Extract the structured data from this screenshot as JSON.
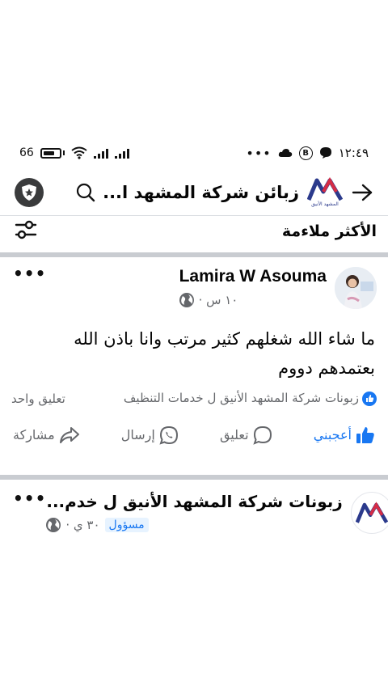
{
  "status_bar": {
    "battery": "66",
    "time": "١٢:٤٩"
  },
  "header": {
    "title": "زبائن شركة المشهد ا...",
    "logo_text": "المشهد الأنيق"
  },
  "sort": {
    "label": "الأكثر ملاءمة"
  },
  "post1": {
    "author": "Lamira W Asouma",
    "time": "١٠ س ·",
    "body": "ما شاء الله شغلهم كثير مرتب وانا باذن الله بعتمدهم دووم",
    "reaction_text": "زبونات شركة المشهد الأنيق ل خدمات التنظيف",
    "comment_count": "تعليق واحد",
    "actions": {
      "like": "أعجبني",
      "comment": "تعليق",
      "send": "إرسال",
      "share": "مشاركة"
    }
  },
  "post2": {
    "author": "زبونات شركة المشهد الأنيق ل خدم...",
    "badge": "مسؤول",
    "time": "٣٠ ي ·"
  },
  "colors": {
    "accent": "#1877f2",
    "muted": "#65676b",
    "divider": "#c9ccd1"
  }
}
